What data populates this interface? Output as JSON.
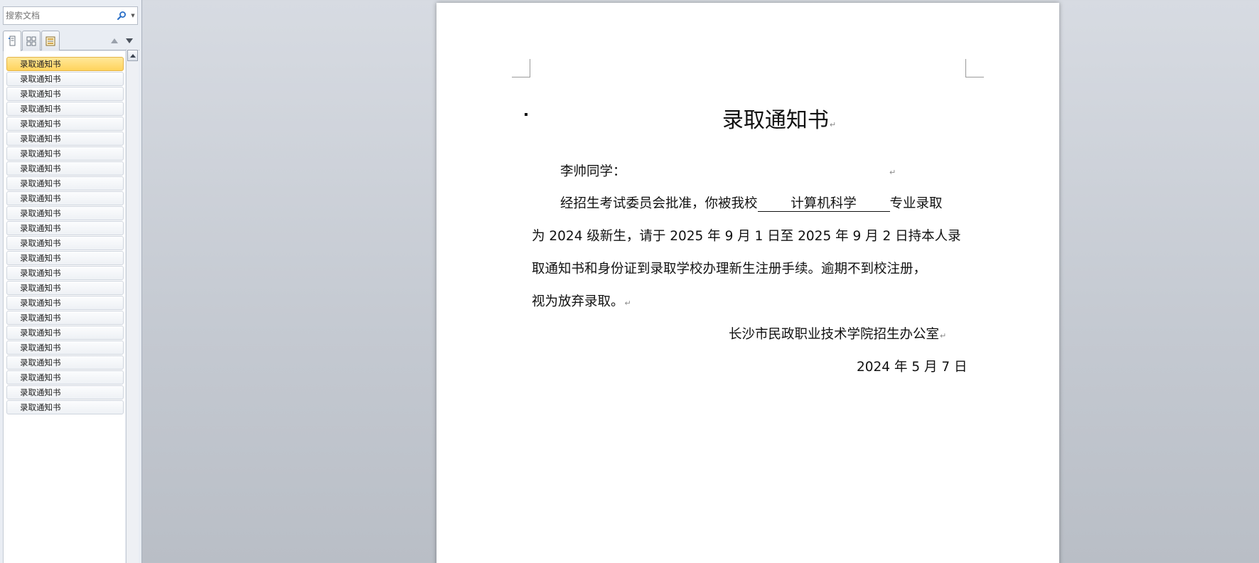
{
  "nav": {
    "search_placeholder": "搜索文档",
    "headings": [
      "录取通知书",
      "录取通知书",
      "录取通知书",
      "录取通知书",
      "录取通知书",
      "录取通知书",
      "录取通知书",
      "录取通知书",
      "录取通知书",
      "录取通知书",
      "录取通知书",
      "录取通知书",
      "录取通知书",
      "录取通知书",
      "录取通知书",
      "录取通知书",
      "录取通知书",
      "录取通知书",
      "录取通知书",
      "录取通知书",
      "录取通知书",
      "录取通知书",
      "录取通知书",
      "录取通知书"
    ],
    "selected_index": 0
  },
  "document": {
    "title": "录取通知书",
    "greeting": "李帅同学：",
    "line1_pre": "经招生考试委员会批准，你被我校",
    "major": "计算机科学",
    "line1_post": "专业录取",
    "line2": "为 2024 级新生，请于 2025 年 9 月 1 日至 2025 年 9 月 2 日持本人录",
    "line3": "取通知书和身份证到录取学校办理新生注册手续。逾期不到校注册，",
    "line4": "视为放弃录取。",
    "signature": "长沙市民政职业技术学院招生办公室",
    "date": "2024 年 5 月 7 日",
    "paragraph_mark": "↵"
  },
  "colors": {
    "selected_heading": "#ffd35c",
    "search_icon": "#2a6fc7"
  }
}
